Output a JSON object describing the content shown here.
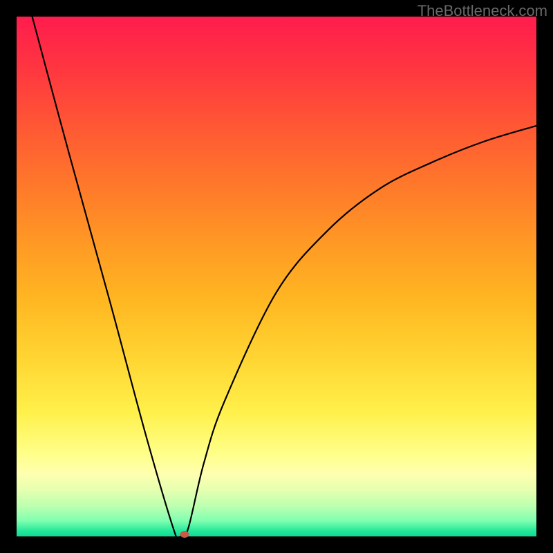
{
  "watermark": "TheBottleneck.com",
  "chart_data": {
    "type": "line",
    "title": "",
    "xlabel": "",
    "ylabel": "",
    "xlim": [
      0,
      100
    ],
    "ylim": [
      0,
      100
    ],
    "grid": false,
    "legend": false,
    "series": [
      {
        "name": "curve",
        "x": [
          3,
          10,
          18,
          25,
          30.5,
          31.5,
          33,
          36,
          40,
          50,
          60,
          70,
          80,
          90,
          100
        ],
        "y": [
          100,
          74,
          45,
          19,
          0.5,
          0,
          1.5,
          14,
          26,
          47,
          59,
          67,
          72,
          76,
          79
        ]
      }
    ],
    "marker": {
      "x": 32.3,
      "y": 0.4,
      "color": "#c85a4a"
    },
    "background_gradient": [
      "#ff1c4d",
      "#ffd633",
      "#ffff88",
      "#20e898"
    ]
  }
}
